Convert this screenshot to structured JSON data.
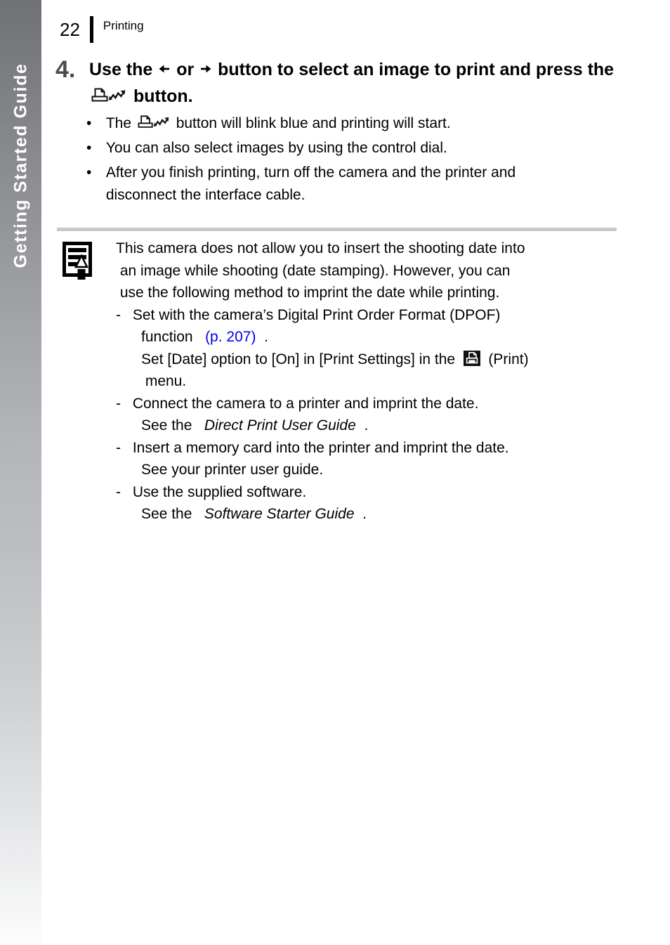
{
  "side_tab": {
    "label": "Getting Started Guide"
  },
  "header": {
    "page_number": "22",
    "title": "Printing"
  },
  "step": {
    "number": "4.",
    "heading_part1": "Use the",
    "heading_or": "or",
    "heading_part2": "button to select an image to print and press the",
    "heading_part3": "button.",
    "left_arrow_icon": "arrow-left-icon",
    "right_arrow_icon": "arrow-right-icon",
    "print_share_icon": "print-share-button-icon",
    "bullets": [
      {
        "marker": "•",
        "pre": "The",
        "icon": "print-share-button-icon",
        "post": "button will blink blue and printing will start."
      },
      {
        "marker": "•",
        "pre": "You can also select images by using the control dial.",
        "icon": "",
        "post": ""
      },
      {
        "marker": "•",
        "pre": "After you finish printing, turn off the camera and the printer and",
        "icon": "",
        "post": "",
        "continuation": "disconnect the interface cable."
      }
    ]
  },
  "note": {
    "icon": "note-pencil-document-icon",
    "paragraph": [
      "This camera does not allow you to insert the shooting date into",
      "an image while shooting (date stamping). However, you can",
      "use the following method to imprint the date while printing."
    ],
    "items": [
      {
        "dash": "-",
        "line1": "Set with the camera’s Digital Print Order Format (DPOF)",
        "line2_pre": "function ",
        "line2_ref": "(p. 207)",
        "line2_post": ".",
        "line3_pre": "Set [Date] option to [On] in [Print Settings] in the ",
        "line3_icon": "print-menu-icon",
        "line3_post": " (Print)",
        "line4": "menu."
      },
      {
        "dash": "-",
        "line1": "Connect the camera to a printer and imprint the date.",
        "line2_pre": "See the ",
        "line2_italic": "Direct Print User Guide",
        "line2_post": "."
      },
      {
        "dash": "-",
        "line1": "Insert a memory card into the printer and imprint the date.",
        "line2_pre": "See your printer user guide.",
        "line2_italic": "",
        "line2_post": ""
      },
      {
        "dash": "-",
        "line1": "Use the supplied software.",
        "line2_pre": "See the ",
        "line2_italic": "Software Starter Guide",
        "line2_post": "."
      }
    ]
  },
  "colors": {
    "page_reference_link": "#0000ee",
    "step_number": "#4b4b4b",
    "rule": "#c9c9c9",
    "tab_gradient_top": "#6f7175",
    "tab_gradient_bottom": "#fcfcfc"
  }
}
